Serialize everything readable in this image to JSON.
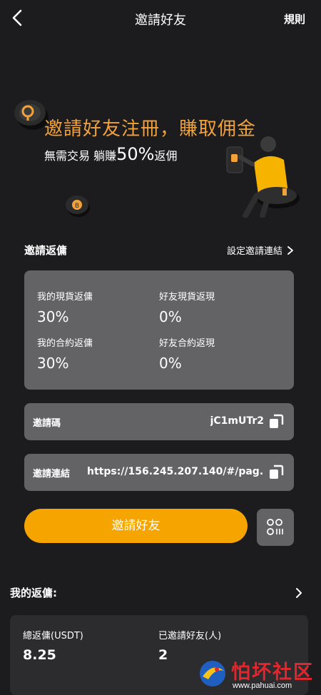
{
  "header": {
    "title": "邀請好友",
    "rules": "規則"
  },
  "banner": {
    "headline": "邀請好友注冊，賺取佣金",
    "sub_before": "無需交易 躺賺",
    "sub_percent": "50%",
    "sub_after": "返佣"
  },
  "rebate_section": {
    "title": "邀請返傭",
    "link": "設定邀請連結"
  },
  "stats": [
    {
      "label": "我的現貨返傭",
      "value": "30%"
    },
    {
      "label": "好友現貨返現",
      "value": "0%"
    },
    {
      "label": "我的合約返傭",
      "value": "30%"
    },
    {
      "label": "好友合約返現",
      "value": "0%"
    }
  ],
  "invite_code": {
    "label": "邀請碼",
    "value": "jC1mUTr2"
  },
  "invite_link": {
    "label": "邀請連結",
    "value": "https://156.245.207.140/#/pag..."
  },
  "invite_button": "邀請好友",
  "my_rebate": {
    "title": "我的返傭:",
    "total_label": "總返傭(USDT)",
    "total_value": "8.25",
    "invited_label": "已邀請好友(人)",
    "invited_value": "2"
  },
  "watermark": {
    "title": "怕坏社区",
    "url": "www.pahuai.com"
  },
  "colors": {
    "accent": "#f6a500",
    "headline": "#f3a23a",
    "card": "#636366",
    "background": "#1c1c1e",
    "watermark": "#e3262d"
  }
}
